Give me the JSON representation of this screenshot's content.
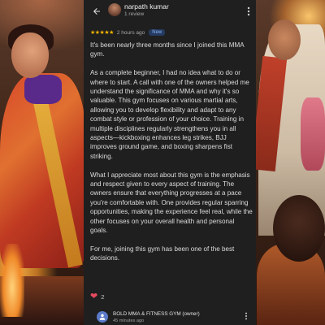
{
  "review": {
    "reviewer_name": "narpath kumar",
    "review_count": "1 review",
    "stars": "★★★★★",
    "time_ago": "2 hours ago",
    "badge": "New",
    "paragraphs": [
      "It's been nearly three months since I joined this MMA gym.",
      "As a complete beginner, I had no idea what to do or where to start. A call with one of the owners helped me understand the significance of MMA and why it's so valuable. This gym focuses on various martial arts, allowing you to develop flexibility and adapt to any combat style or profession of your choice. Training in multiple disciplines regularly strengthens you in all aspects—kickboxing enhances leg strikes, BJJ improves ground game, and boxing sharpens fist striking.",
      "What I appreciate most about this gym is the emphasis and respect given to every aspect of training. The owners ensure that everything progresses at a pace you're comfortable with. One provides regular sparring opportunities, making the experience feel real, while the other focuses on your overall health and personal goals.",
      "For me, joining this gym has been one of the best decisions."
    ],
    "like_count": "2"
  },
  "owner_reply": {
    "name": "BOLD MMA & FITNESS GYM (owner)",
    "time_ago": "45 minutes ago"
  },
  "icons": {
    "back": "arrow-back-icon",
    "more": "more-vert-icon",
    "like": "heart-icon"
  },
  "colors": {
    "card_bg": "#1f1f1f",
    "star": "#f4b400",
    "badge_text": "#8ab4f8",
    "heart": "#e84a5f"
  }
}
